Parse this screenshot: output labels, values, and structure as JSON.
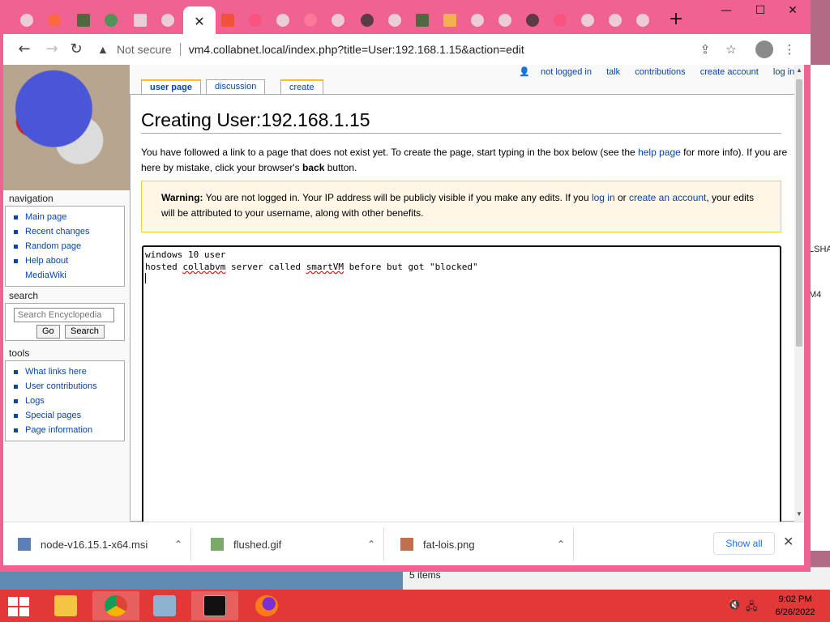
{
  "browser": {
    "tabs": [
      {
        "name": "tab-1",
        "icon": "globe-icon"
      },
      {
        "name": "tab-2",
        "icon": "red-badge-icon"
      },
      {
        "name": "tab-3",
        "icon": "sqlite-icon"
      },
      {
        "name": "tab-4",
        "icon": "n-icon"
      },
      {
        "name": "tab-5",
        "icon": "download-icon"
      },
      {
        "name": "tab-6",
        "icon": "globe-icon"
      },
      {
        "name": "tab-7-active",
        "icon": "close-icon"
      }
    ],
    "active_tab_close": "✕",
    "new_tab": "+",
    "window_controls": {
      "minimize": "—",
      "maximize": "☐",
      "close": "✕"
    },
    "omnibox": {
      "security_label": "Not secure",
      "url": "vm4.collabnet.local/index.php?title=User:192.168.1.15&action=edit"
    }
  },
  "wiki": {
    "personal_tools": [
      "not logged in",
      "talk",
      "contributions",
      "create account",
      "log in"
    ],
    "page_tabs": {
      "user_page": "user page",
      "discussion": "discussion",
      "create": "create"
    },
    "heading": "Creating User:192.168.1.15",
    "intro": {
      "part1": "You have followed a link to a page that does not exist yet. To create the page, start typing in the box below (see the ",
      "help_link": "help page",
      "part2": " for more info). If you are here by mistake, click your browser's ",
      "back": "back",
      "part3": " button."
    },
    "warning": {
      "label": "Warning:",
      "part1": " You are not logged in. Your IP address will be publicly visible if you make any edits. If you ",
      "login": "log in",
      "or": " or ",
      "create": "create an account",
      "part2": ", your edits will be attributed to your username, along with other benefits."
    },
    "editbox": {
      "line1": "windows 10 user",
      "line2_a": "hosted ",
      "line2_b": "collabvm",
      "line2_c": " server called ",
      "line2_d": "smartVM",
      "line2_e": " before but got \"blocked\""
    },
    "navigation": {
      "title": "navigation",
      "items": [
        "Main page",
        "Recent changes",
        "Random page",
        "Help about MediaWiki"
      ]
    },
    "search": {
      "title": "search",
      "placeholder": "Search Encyclopedia",
      "go": "Go",
      "search": "Search"
    },
    "tools": {
      "title": "tools",
      "items": [
        "What links here",
        "User contributions",
        "Logs",
        "Special pages",
        "Page information"
      ]
    }
  },
  "downloads": {
    "items": [
      {
        "name": "node-v16.15.1-x64.msi",
        "icon": "installer-icon"
      },
      {
        "name": "flushed.gif",
        "icon": "image-icon"
      },
      {
        "name": "fat-lois.png",
        "icon": "image-icon"
      }
    ],
    "show_all": "Show all",
    "close": "✕"
  },
  "desktop": {
    "behind_window_text": "5 items",
    "edge_text_1": "LSHA",
    "edge_text_2": "M4"
  },
  "taskbar": {
    "apps": [
      "file-explorer",
      "chrome",
      "notepad",
      "command-prompt",
      "firefox"
    ],
    "time": "9:02 PM",
    "date": "6/26/2022"
  }
}
